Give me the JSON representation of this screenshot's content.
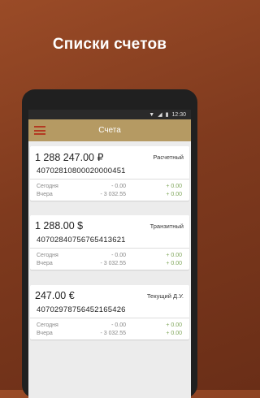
{
  "headline": "Списки счетов",
  "status": {
    "time": "12:30"
  },
  "appbar": {
    "title": "Счета"
  },
  "accounts": [
    {
      "amount": "1 288 247.00 ₽",
      "type": "Расчетный",
      "number": "40702810800020000451",
      "today_label": "Сегодня",
      "today_out": "- 0.00",
      "today_in": "+ 0.00",
      "yesterday_label": "Вчера",
      "yesterday_out": "- 3 032.55",
      "yesterday_in": "+ 0.00"
    },
    {
      "amount": "1 288.00 $",
      "type": "Транзитный",
      "number": "40702840756765413621",
      "today_label": "Сегодня",
      "today_out": "- 0.00",
      "today_in": "+ 0.00",
      "yesterday_label": "Вчера",
      "yesterday_out": "- 3 032.55",
      "yesterday_in": "+ 0.00"
    },
    {
      "amount": "247.00 €",
      "type": "Текущий Д.У.",
      "number": "40702978756452165426",
      "today_label": "Сегодня",
      "today_out": "- 0.00",
      "today_in": "+ 0.00",
      "yesterday_label": "Вчера",
      "yesterday_out": "- 3 032.55",
      "yesterday_in": "+ 0.00"
    }
  ]
}
